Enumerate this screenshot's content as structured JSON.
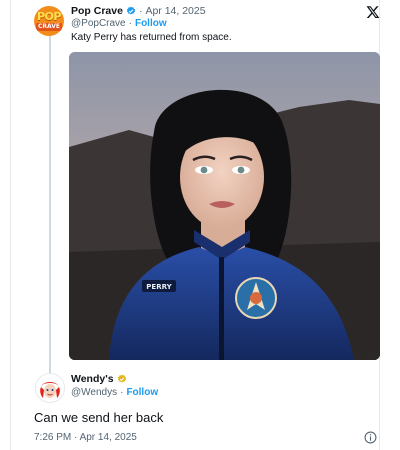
{
  "original": {
    "display_name": "Pop Crave",
    "dot": "·",
    "date": "Apr 14, 2025",
    "handle": "@PopCrave",
    "separator": "·",
    "follow_label": "Follow",
    "text": "Katy Perry has returned from space.",
    "avatar_logo_line1": "POP",
    "avatar_logo_line2": "CRAVE",
    "patch_text": "PERRY"
  },
  "reply": {
    "display_name": "Wendy's",
    "handle": "@Wendys",
    "separator": "·",
    "follow_label": "Follow",
    "text": "Can we send her back",
    "timestamp": "7:26 PM · Apr 14, 2025"
  },
  "icons": {
    "platform": "x-logo-icon",
    "verified": "verified-badge-icon",
    "gold_verified": "gold-verified-badge-icon",
    "info": "info-icon"
  },
  "colors": {
    "link_blue": "#1d9bf0",
    "muted_text": "#536471",
    "suit_blue": "#1f3d8a"
  }
}
